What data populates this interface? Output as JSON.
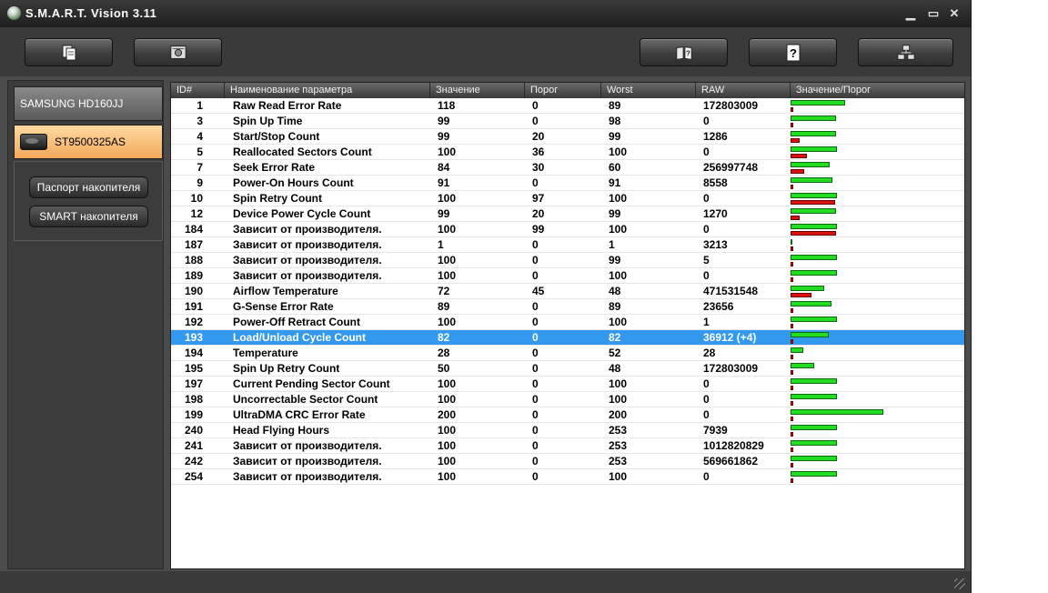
{
  "window": {
    "title": "S.M.A.R.T. Vision 3.11",
    "minimize": "▁",
    "maximize": "▭",
    "close": "✕"
  },
  "toolbar": {
    "buttons": [
      {
        "icon": "document-copy-icon"
      },
      {
        "icon": "settings-chip-icon"
      },
      {
        "icon": "book-help-icon"
      },
      {
        "icon": "question-help-icon"
      },
      {
        "icon": "network-icon"
      }
    ]
  },
  "drives": {
    "samsung": "SAMSUNG HD160JJ",
    "seagate": "ST9500325AS"
  },
  "panel_buttons": {
    "passport": "Паспорт накопителя",
    "smart": "SMART накопителя"
  },
  "columns": {
    "id": "ID#",
    "name": "Наименование параметра",
    "value": "Значение",
    "threshold": "Порог",
    "worst": "Worst",
    "raw": "RAW",
    "ratio": "Значение/Порог"
  },
  "rows": [
    {
      "id": "1",
      "name": "Raw Read Error Rate",
      "value": "118",
      "threshold": "0",
      "worst": "89",
      "raw": "172803009"
    },
    {
      "id": "3",
      "name": "Spin Up Time",
      "value": "99",
      "threshold": "0",
      "worst": "98",
      "raw": "0"
    },
    {
      "id": "4",
      "name": "Start/Stop Count",
      "value": "99",
      "threshold": "20",
      "worst": "99",
      "raw": "1286"
    },
    {
      "id": "5",
      "name": "Reallocated Sectors Count",
      "value": "100",
      "threshold": "36",
      "worst": "100",
      "raw": "0"
    },
    {
      "id": "7",
      "name": "Seek Error Rate",
      "value": "84",
      "threshold": "30",
      "worst": "60",
      "raw": "256997748"
    },
    {
      "id": "9",
      "name": "Power-On Hours Count",
      "value": "91",
      "threshold": "0",
      "worst": "91",
      "raw": "8558"
    },
    {
      "id": "10",
      "name": "Spin Retry Count",
      "value": "100",
      "threshold": "97",
      "worst": "100",
      "raw": "0"
    },
    {
      "id": "12",
      "name": "Device Power Cycle Count",
      "value": "99",
      "threshold": "20",
      "worst": "99",
      "raw": "1270"
    },
    {
      "id": "184",
      "name": "Зависит от производителя.",
      "value": "100",
      "threshold": "99",
      "worst": "100",
      "raw": "0"
    },
    {
      "id": "187",
      "name": "Зависит от производителя.",
      "value": "1",
      "threshold": "0",
      "worst": "1",
      "raw": "3213"
    },
    {
      "id": "188",
      "name": "Зависит от производителя.",
      "value": "100",
      "threshold": "0",
      "worst": "99",
      "raw": "5"
    },
    {
      "id": "189",
      "name": "Зависит от производителя.",
      "value": "100",
      "threshold": "0",
      "worst": "100",
      "raw": "0"
    },
    {
      "id": "190",
      "name": "Airflow Temperature",
      "value": "72",
      "threshold": "45",
      "worst": "48",
      "raw": "471531548"
    },
    {
      "id": "191",
      "name": "G-Sense Error Rate",
      "value": "89",
      "threshold": "0",
      "worst": "89",
      "raw": "23656"
    },
    {
      "id": "192",
      "name": "Power-Off Retract Count",
      "value": "100",
      "threshold": "0",
      "worst": "100",
      "raw": "1"
    },
    {
      "id": "193",
      "name": "Load/Unload Cycle Count",
      "value": "82",
      "threshold": "0",
      "worst": "82",
      "raw": "36912 (+4)",
      "selected": true
    },
    {
      "id": "194",
      "name": "Temperature",
      "value": "28",
      "threshold": "0",
      "worst": "52",
      "raw": "28"
    },
    {
      "id": "195",
      "name": "Spin Up Retry Count",
      "value": "50",
      "threshold": "0",
      "worst": "48",
      "raw": "172803009"
    },
    {
      "id": "197",
      "name": "Current Pending Sector Count",
      "value": "100",
      "threshold": "0",
      "worst": "100",
      "raw": "0"
    },
    {
      "id": "198",
      "name": "Uncorrectable Sector Count",
      "value": "100",
      "threshold": "0",
      "worst": "100",
      "raw": "0"
    },
    {
      "id": "199",
      "name": "UltraDMA CRC Error Rate",
      "value": "200",
      "threshold": "0",
      "worst": "200",
      "raw": "0"
    },
    {
      "id": "240",
      "name": "Head Flying Hours",
      "value": "100",
      "threshold": "0",
      "worst": "253",
      "raw": "7939"
    },
    {
      "id": "241",
      "name": "Зависит от производителя.",
      "value": "100",
      "threshold": "0",
      "worst": "253",
      "raw": "1012820829"
    },
    {
      "id": "242",
      "name": "Зависит от производителя.",
      "value": "100",
      "threshold": "0",
      "worst": "253",
      "raw": "569661862"
    },
    {
      "id": "254",
      "name": "Зависит от производителя.",
      "value": "100",
      "threshold": "0",
      "worst": "100",
      "raw": "0"
    }
  ],
  "colors": {
    "value_bar": "#22dd22",
    "threshold_bar": "#dd1111",
    "selection": "#3399ee",
    "selected_drive": "#f2a95c"
  }
}
